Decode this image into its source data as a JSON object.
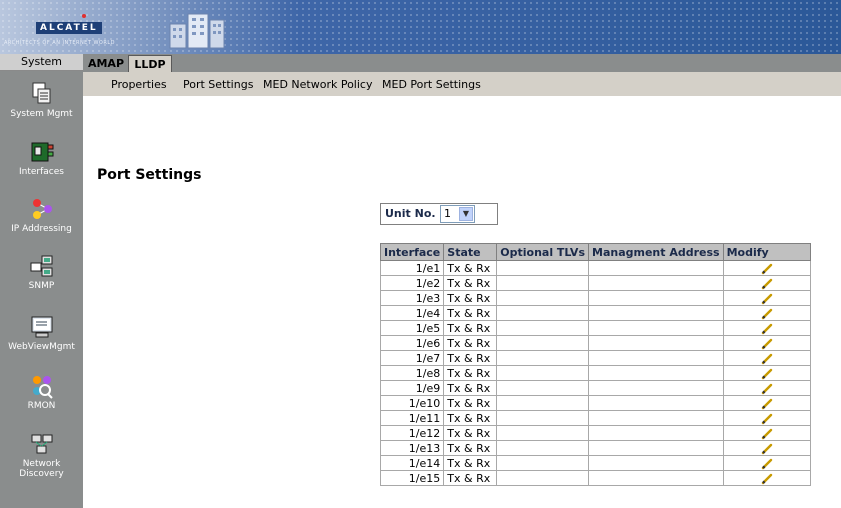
{
  "banner": {
    "logo_text": "ALCATEL",
    "tagline": "ARCHITECTS OF AN INTERNET WORLD"
  },
  "left_header": "System",
  "sidebar": {
    "items": [
      {
        "label": "System Mgmt",
        "icon": "system-mgmt-icon"
      },
      {
        "label": "Interfaces",
        "icon": "interfaces-icon"
      },
      {
        "label": "IP Addressing",
        "icon": "ip-addressing-icon"
      },
      {
        "label": "SNMP",
        "icon": "snmp-icon"
      },
      {
        "label": "WebViewMgmt",
        "icon": "webview-mgmt-icon"
      },
      {
        "label": "RMON",
        "icon": "rmon-icon"
      },
      {
        "label": "Network",
        "label2": "Discovery",
        "icon": "network-discovery-icon"
      }
    ]
  },
  "tabs": [
    {
      "label": "AMAP"
    },
    {
      "label": "LLDP",
      "active": true
    }
  ],
  "subnav": [
    "Properties",
    "Port Settings",
    "MED Network Policy",
    "MED Port Settings"
  ],
  "main": {
    "title": "Port Settings",
    "unit": {
      "label": "Unit No.",
      "value": "1"
    },
    "table": {
      "headers": [
        "Interface",
        "State",
        "Optional TLVs",
        "Managment Address",
        "Modify"
      ],
      "rows": [
        {
          "interface": "1/e1",
          "state": "Tx & Rx"
        },
        {
          "interface": "1/e2",
          "state": "Tx & Rx"
        },
        {
          "interface": "1/e3",
          "state": "Tx & Rx"
        },
        {
          "interface": "1/e4",
          "state": "Tx & Rx"
        },
        {
          "interface": "1/e5",
          "state": "Tx & Rx"
        },
        {
          "interface": "1/e6",
          "state": "Tx & Rx"
        },
        {
          "interface": "1/e7",
          "state": "Tx & Rx"
        },
        {
          "interface": "1/e8",
          "state": "Tx & Rx"
        },
        {
          "interface": "1/e9",
          "state": "Tx & Rx"
        },
        {
          "interface": "1/e10",
          "state": "Tx & Rx"
        },
        {
          "interface": "1/e11",
          "state": "Tx & Rx"
        },
        {
          "interface": "1/e12",
          "state": "Tx & Rx"
        },
        {
          "interface": "1/e13",
          "state": "Tx & Rx"
        },
        {
          "interface": "1/e14",
          "state": "Tx & Rx"
        },
        {
          "interface": "1/e15",
          "state": "Tx & Rx"
        }
      ]
    }
  },
  "colors": {
    "sidebar_bg": "#8a8d8d",
    "subnav_bg": "#d4d0c8",
    "banner_blue": "#2b5898",
    "header_text": "#1b2a4a"
  }
}
